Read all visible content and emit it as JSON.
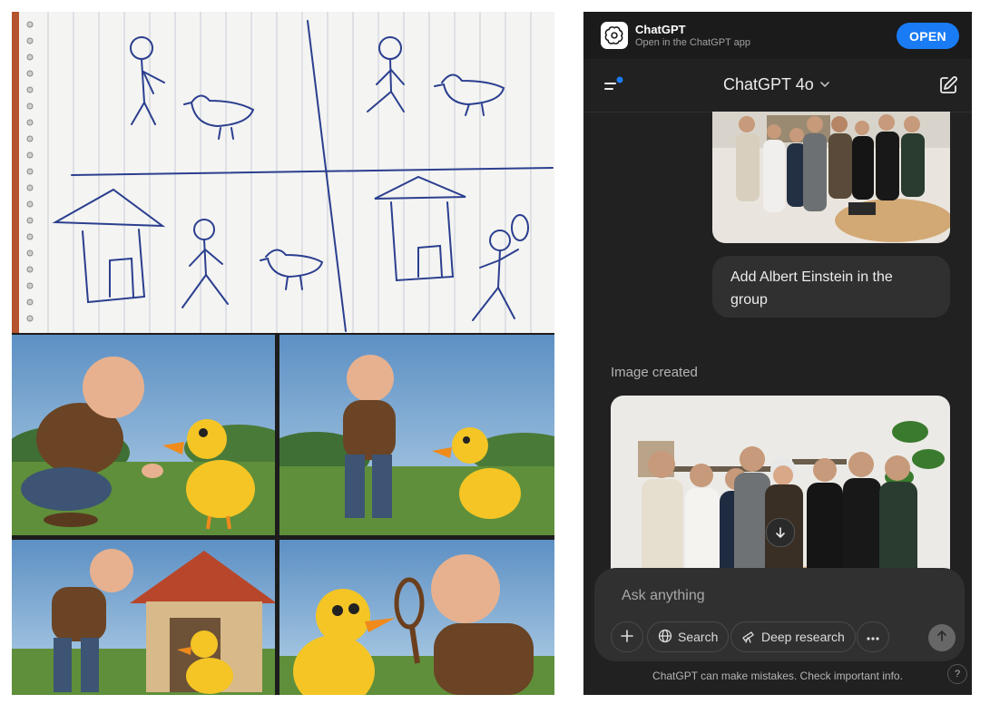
{
  "banner": {
    "app_name": "ChatGPT",
    "subtitle": "Open in the ChatGPT app",
    "open_label": "OPEN"
  },
  "header": {
    "model_label": "ChatGPT 4o"
  },
  "conversation": {
    "user_message": "Add Albert Einstein in the group",
    "assistant_status": "Image created"
  },
  "composer": {
    "placeholder": "Ask anything",
    "search_label": "Search",
    "deep_research_label": "Deep research"
  },
  "footer": {
    "disclaimer": "ChatGPT can make mistakes. Check important info.",
    "help_label": "?"
  },
  "icons": {
    "app": "openai-logo-icon",
    "menu": "sidebar-menu-icon",
    "new_chat": "edit-icon",
    "download": "download-arrow-icon",
    "plus": "plus-icon",
    "globe": "globe-icon",
    "telescope": "telescope-icon",
    "more": "more-dots-icon",
    "send": "arrow-up-icon"
  },
  "colors": {
    "accent": "#1a7cf5",
    "background": "#212121",
    "bubble": "#303030"
  }
}
